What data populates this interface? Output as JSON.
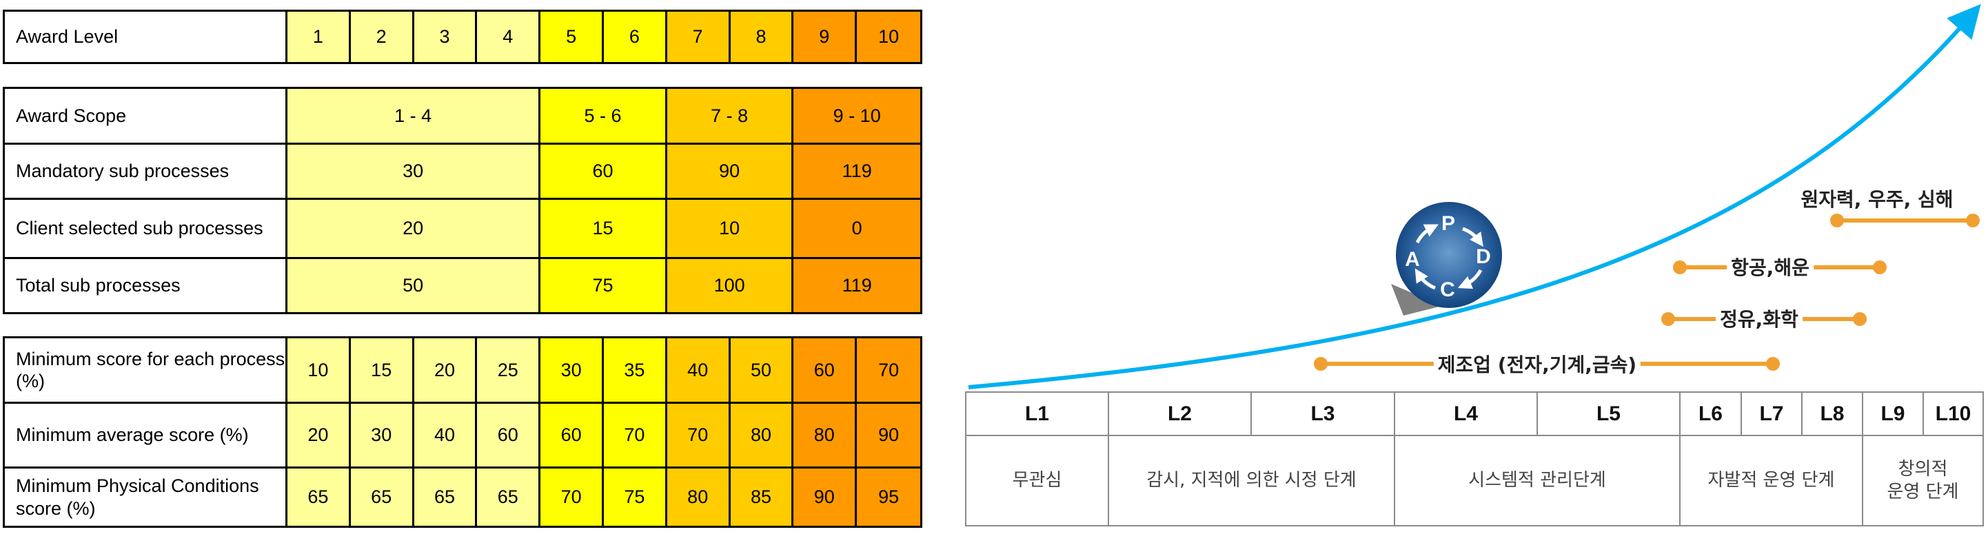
{
  "colors": {
    "pale_yellow": "#ffff99",
    "yellow": "#ffff00",
    "amber": "#ffcc00",
    "orange": "#ff9900",
    "curve_blue": "#00b0f0",
    "industry_orange": "#f0a030",
    "pdca_blue": "#1b4f8a"
  },
  "award_level_table": {
    "label": "Award Level",
    "levels": [
      "1",
      "2",
      "3",
      "4",
      "5",
      "6",
      "7",
      "8",
      "9",
      "10"
    ]
  },
  "scope_table": {
    "rows": [
      {
        "label": "Award Scope",
        "values": [
          "1 - 4",
          "5 - 6",
          "7 - 8",
          "9 - 10"
        ]
      },
      {
        "label": "Mandatory sub processes",
        "values": [
          "30",
          "60",
          "90",
          "119"
        ]
      },
      {
        "label": "Client selected sub processes",
        "values": [
          "20",
          "15",
          "10",
          "0"
        ]
      },
      {
        "label": "Total sub processes",
        "values": [
          "50",
          "75",
          "100",
          "119"
        ]
      }
    ]
  },
  "score_table": {
    "rows": [
      {
        "label": "Minimum score for each process (%)",
        "values": [
          "10",
          "15",
          "20",
          "25",
          "30",
          "35",
          "40",
          "50",
          "60",
          "70"
        ]
      },
      {
        "label": "Minimum average score (%)",
        "values": [
          "20",
          "30",
          "40",
          "60",
          "60",
          "70",
          "70",
          "80",
          "80",
          "90"
        ]
      },
      {
        "label": "Minimum Physical Conditions score (%)",
        "values": [
          "65",
          "65",
          "65",
          "65",
          "70",
          "75",
          "80",
          "85",
          "90",
          "95"
        ]
      }
    ]
  },
  "maturity_diagram": {
    "pdca": {
      "plan": "P",
      "do": "D",
      "check": "C",
      "act": "A"
    },
    "industries": [
      {
        "label": "원자력, 우주, 심해"
      },
      {
        "label": "항공,해운"
      },
      {
        "label": "정유,화학"
      },
      {
        "label": "제조업 (전자,기계,금속)"
      }
    ],
    "levels": [
      "L1",
      "L2",
      "L3",
      "L4",
      "L5",
      "L6",
      "L7",
      "L8",
      "L9",
      "L10"
    ],
    "stages": [
      {
        "label": "무관심"
      },
      {
        "label": "감시, 지적에 의한 시정 단계"
      },
      {
        "label": "시스템적 관리단계"
      },
      {
        "label": "자발적 운영 단계"
      },
      {
        "label": "창의적\n운영 단계"
      }
    ]
  }
}
